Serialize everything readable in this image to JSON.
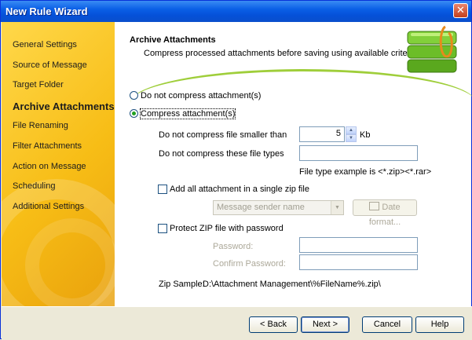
{
  "window": {
    "title": "New Rule Wizard",
    "close_glyph": "✕"
  },
  "sidebar": {
    "items": [
      {
        "label": "General Settings"
      },
      {
        "label": "Source of Message"
      },
      {
        "label": "Target Folder"
      },
      {
        "label": "Archive Attachments"
      },
      {
        "label": "File Renaming"
      },
      {
        "label": "Filter Attachments"
      },
      {
        "label": "Action on Message"
      },
      {
        "label": "Scheduling"
      },
      {
        "label": "Additional Settings"
      }
    ],
    "active_index": 3
  },
  "header": {
    "title": "Archive Attachments",
    "subtitle": "Compress processed attachments before saving using available criteria."
  },
  "options": {
    "no_compress_label": "Do not compress attachment(s)",
    "compress_label": "Compress attachment(s)",
    "selected": "compress"
  },
  "form": {
    "min_size_label": "Do not compress file smaller than",
    "min_size_value": "5",
    "min_size_unit": "Kb",
    "exclude_types_label": "Do not compress these file types",
    "exclude_types_value": "",
    "file_type_hint": "File type example is <*.zip><*.rar>",
    "single_zip_label": "Add all attachment in a single zip file",
    "single_zip_checked": false,
    "zip_name_combo_value": "Message sender name",
    "date_format_button": "Date format...",
    "protect_zip_label": "Protect ZIP file with password",
    "protect_zip_checked": false,
    "password_label": "Password:",
    "password_value": "",
    "confirm_password_label": "Confirm Password:",
    "confirm_password_value": "",
    "zip_sample_label": "Zip Sample:",
    "zip_sample_value": "D:\\Attachment Management\\%FileName%.zip\\"
  },
  "footer": {
    "back_label": "< Back",
    "next_label": "Next >",
    "cancel_label": "Cancel",
    "help_label": "Help"
  },
  "colors": {
    "titlebar": "#0550d8",
    "sidebar": "#f7bd16",
    "accent_green": "#9fce3a"
  }
}
